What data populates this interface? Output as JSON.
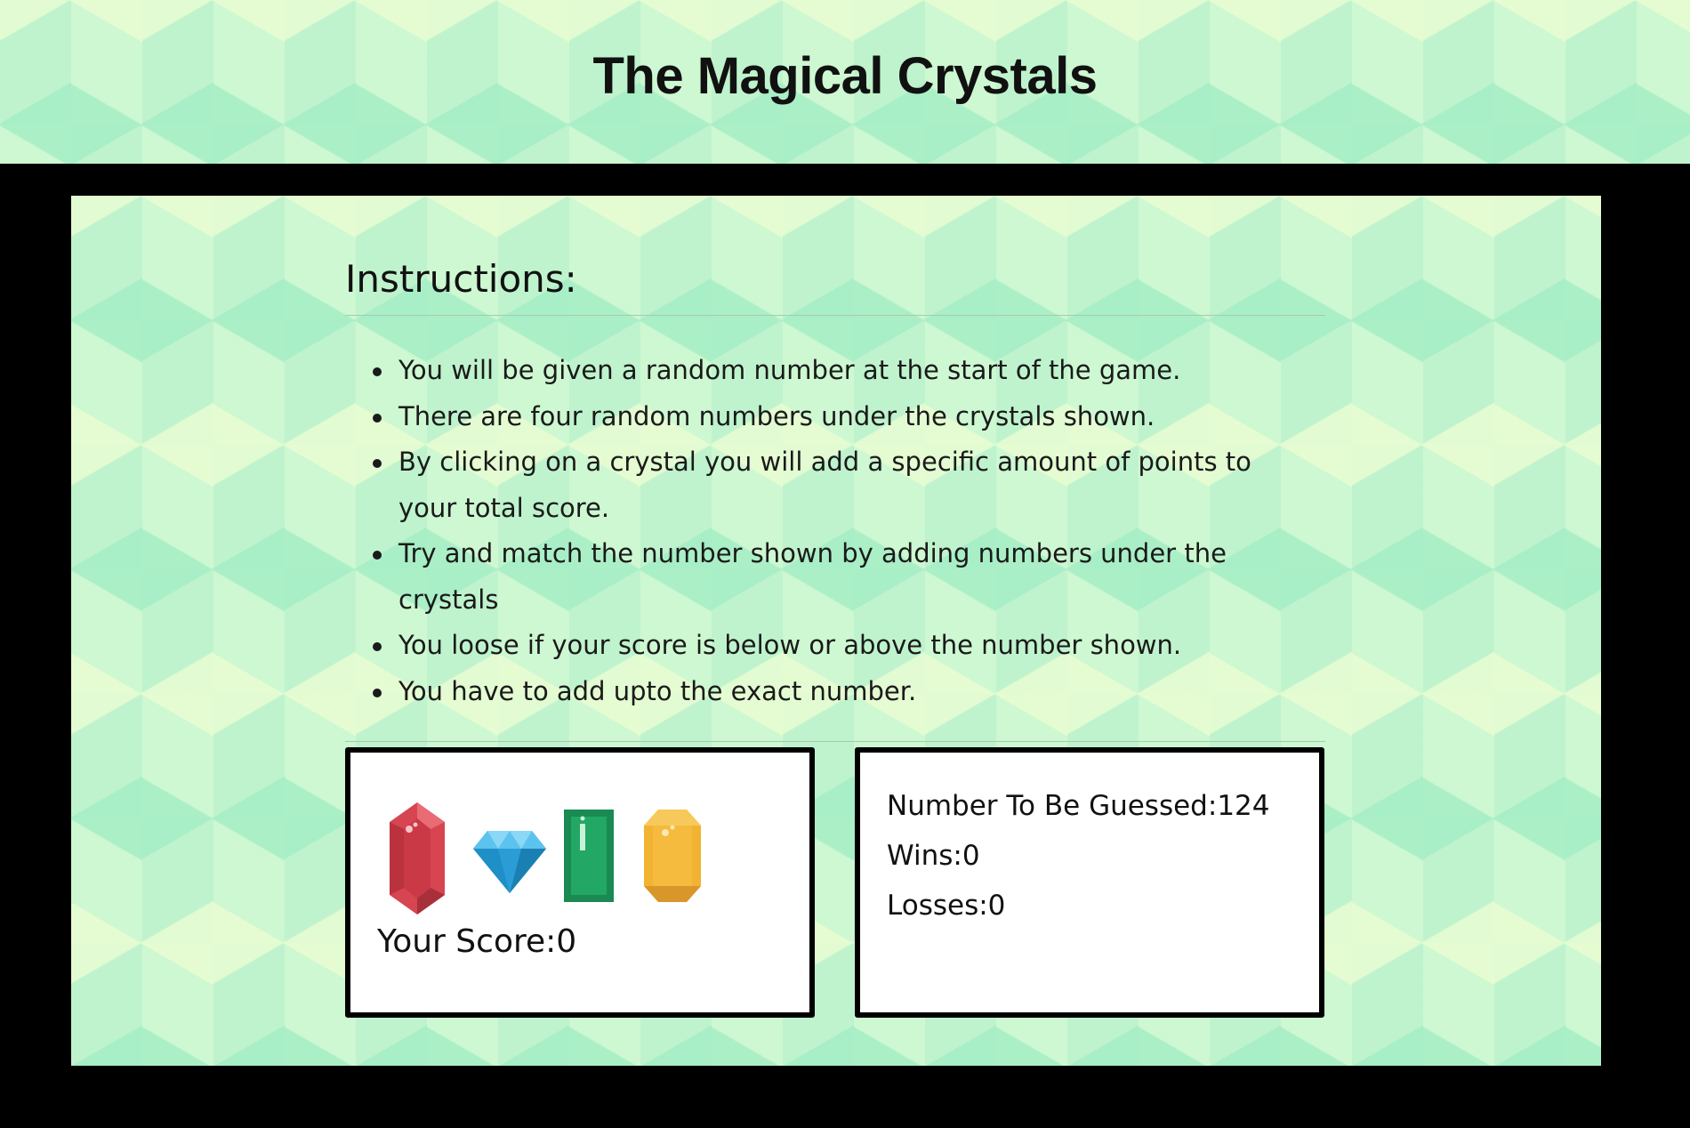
{
  "header": {
    "title": "The Magical Crystals"
  },
  "instructions": {
    "heading": "Instructions:",
    "items": [
      "You will be given a random number at the start of the game.",
      "There are four random numbers under the crystals shown.",
      "By clicking on a crystal you will add a specific amount of points to your total score.",
      "Try and match the number shown by adding numbers under the crystals",
      "You loose if your score is below or above the number shown.",
      "You have to add upto the exact number."
    ]
  },
  "game": {
    "crystals": [
      {
        "icon": "red-crystal-icon",
        "color": "#d64550"
      },
      {
        "icon": "blue-diamond-icon",
        "color": "#2fa8e0"
      },
      {
        "icon": "green-crystal-icon",
        "color": "#1e9a5c"
      },
      {
        "icon": "yellow-crystal-icon",
        "color": "#f2b333"
      }
    ],
    "score_label": "Your Score:",
    "score_value": "0"
  },
  "stats": {
    "target_label": "Number To Be Guessed:",
    "target_value": "124",
    "wins_label": "Wins:",
    "wins_value": "0",
    "losses_label": "Losses:",
    "losses_value": "0"
  },
  "colors": {
    "background_dark": "#000000",
    "pattern_mint": "#bff3cd",
    "pattern_cream": "#e9fdd2",
    "panel_white": "#ffffff"
  }
}
